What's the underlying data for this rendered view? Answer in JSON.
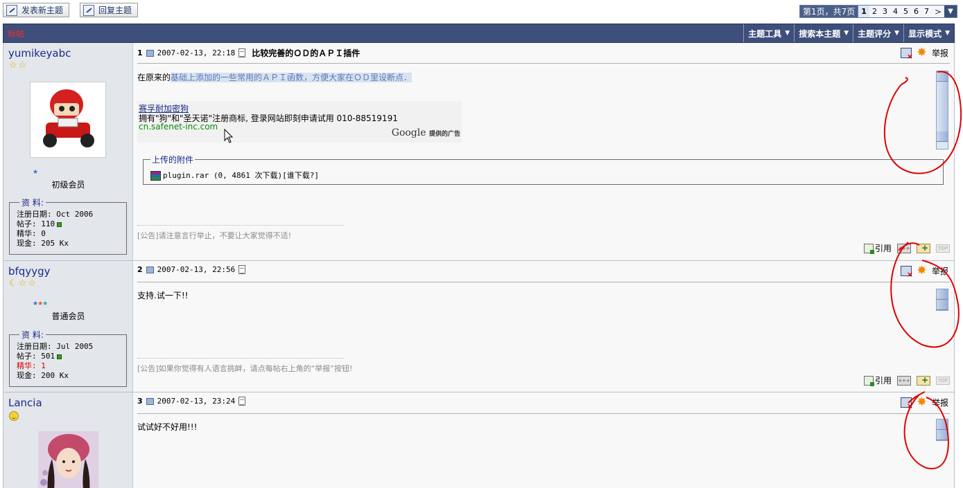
{
  "toolbar": {
    "new_topic": "发表新主题",
    "reply_topic": "回复主题"
  },
  "pager": {
    "summary": "第1页，共7页",
    "pages": [
      "1",
      "2",
      "3",
      "4",
      "5",
      "6",
      "7"
    ],
    "current": "1",
    "next": ">"
  },
  "thread_header": {
    "label": "标帖",
    "tools": [
      {
        "label": "主题工具"
      },
      {
        "label": "搜索本主题"
      },
      {
        "label": "主题评分"
      },
      {
        "label": "显示模式"
      }
    ]
  },
  "posts": [
    {
      "user": "yumikeyabc",
      "rank": "初级会员",
      "info_legend": "资  料:",
      "info": [
        "注册日期: Oct 2006",
        "帖子: 110",
        "精华: 0",
        "现金: 205 Kx"
      ],
      "number": "1",
      "date": "2007-02-13, 22:18",
      "title": "比较完善的ＯＤ的ＡＰＩ插件",
      "report": "举报",
      "body_prefix": "在原来的",
      "body_highlight": "基础上添加的一些常用的ＡＰＩ函数，方便大家在ＯＤ里设断点．",
      "ad": {
        "title": "赛孚耐加密狗",
        "line": "拥有\"狗\"和\"圣天诺\"注册商标, 登录网站即刻申请试用 010-88519191",
        "url": "cn.safenet-inc.com",
        "google": "Google",
        "google_suffix": "提供的广告"
      },
      "attachment_legend": "上传的附件",
      "attachment": "plugin.rar (0, 4861 次下载)[谁下载?]",
      "notice": "[公告]请注意言行举止，不要让大家觉得不适!",
      "quote": "引用"
    },
    {
      "user": "bfqyygy",
      "rank": "普通会员",
      "info_legend": "资  料:",
      "info": [
        "注册日期: Jul 2005",
        "帖子: 501",
        "精华: 1",
        "现金: 200 Kx"
      ],
      "number": "2",
      "date": "2007-02-13, 22:56",
      "report": "举报",
      "body": "支持.试一下!!",
      "notice": "[公告]如果你觉得有人语言挑衅，请点每帖右上角的“举报”按钮!",
      "quote": "引用"
    },
    {
      "user": "Lancia",
      "number": "3",
      "date": "2007-02-13, 23:24",
      "report": "举报",
      "body": "试试好不好用!!!"
    }
  ],
  "colors": {
    "header_bg": "#3d4f7a",
    "annotation_red": "#e00000",
    "link_blue": "#1a2a8a"
  }
}
